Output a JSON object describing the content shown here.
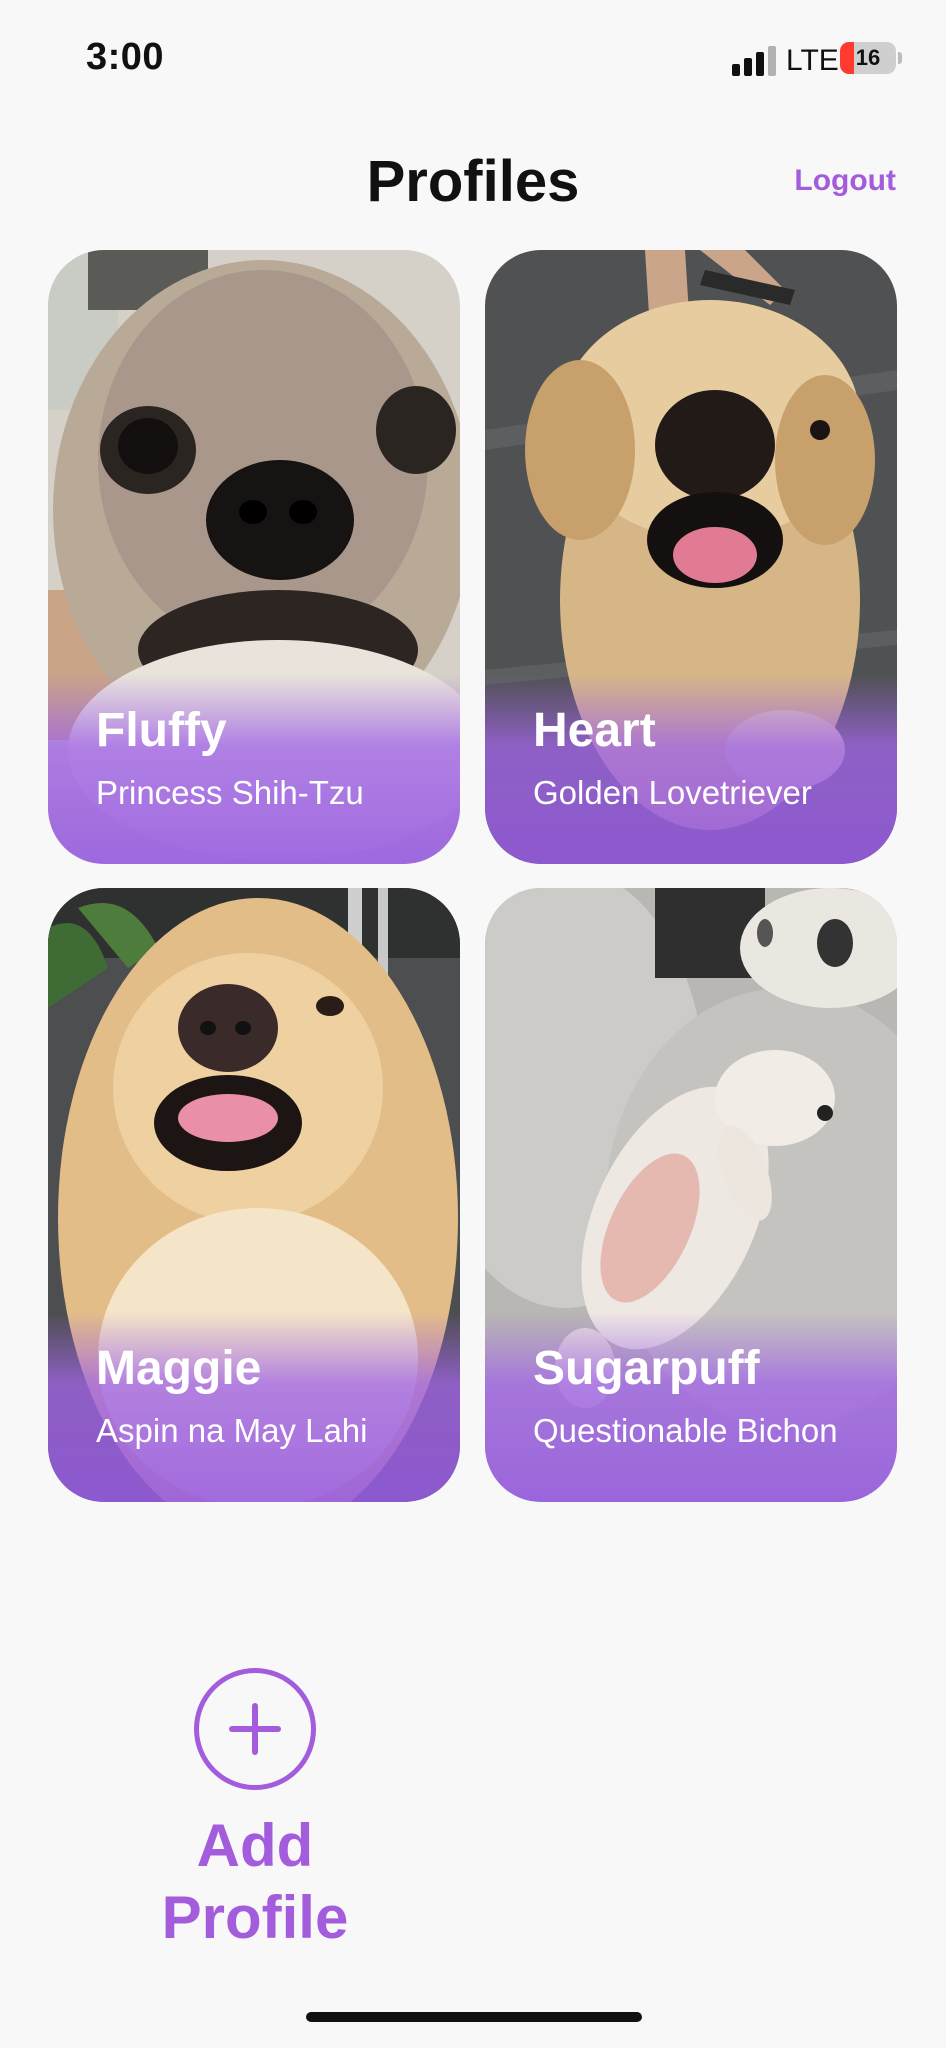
{
  "status_bar": {
    "time": "3:00",
    "network": "LTE",
    "battery": "16"
  },
  "header": {
    "title": "Profiles",
    "logout_label": "Logout"
  },
  "profiles": [
    {
      "name": "Fluffy",
      "breed": "Princess Shih-Tzu"
    },
    {
      "name": "Heart",
      "breed": "Golden Lovetriever"
    },
    {
      "name": "Maggie",
      "breed": "Aspin na May Lahi"
    },
    {
      "name": "Sugarpuff",
      "breed": "Questionable Bichon"
    }
  ],
  "add_profile": {
    "label": "Add Profile"
  },
  "colors": {
    "accent": "#a35cdc",
    "background": "#f8f8f8"
  }
}
